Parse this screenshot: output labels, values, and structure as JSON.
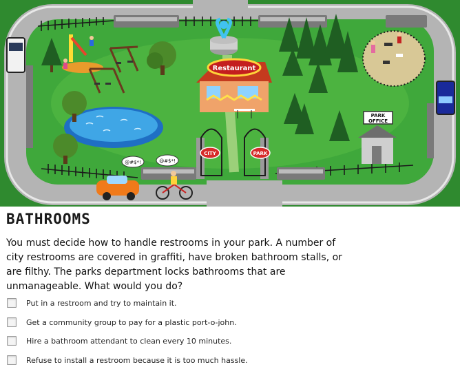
{
  "scene": {
    "restaurant_sign": "Restaurant",
    "park_office_sign_line1": "PARK",
    "park_office_sign_line2": "OFFICE",
    "gate_left_sign": "CITY",
    "gate_right_sign": "PARK",
    "speech_bubble_1": "@#$*!",
    "speech_bubble_2": "@#$*!"
  },
  "heading": "BATHROOMS",
  "question": "You must decide how to handle restrooms in your park. A number of city restrooms are covered in graffiti, have broken bathroom stalls, or are filthy. The parks department locks bathrooms that are unmanageable. What would you do?",
  "options": [
    {
      "label": "Put in a restroom and try to maintain it."
    },
    {
      "label": "Get a community group to pay for a plastic port-o-john."
    },
    {
      "label": "Hire a bathroom attendant to clean every 10 minutes."
    },
    {
      "label": "Refuse to install a restroom because it is too much hassle."
    }
  ]
}
